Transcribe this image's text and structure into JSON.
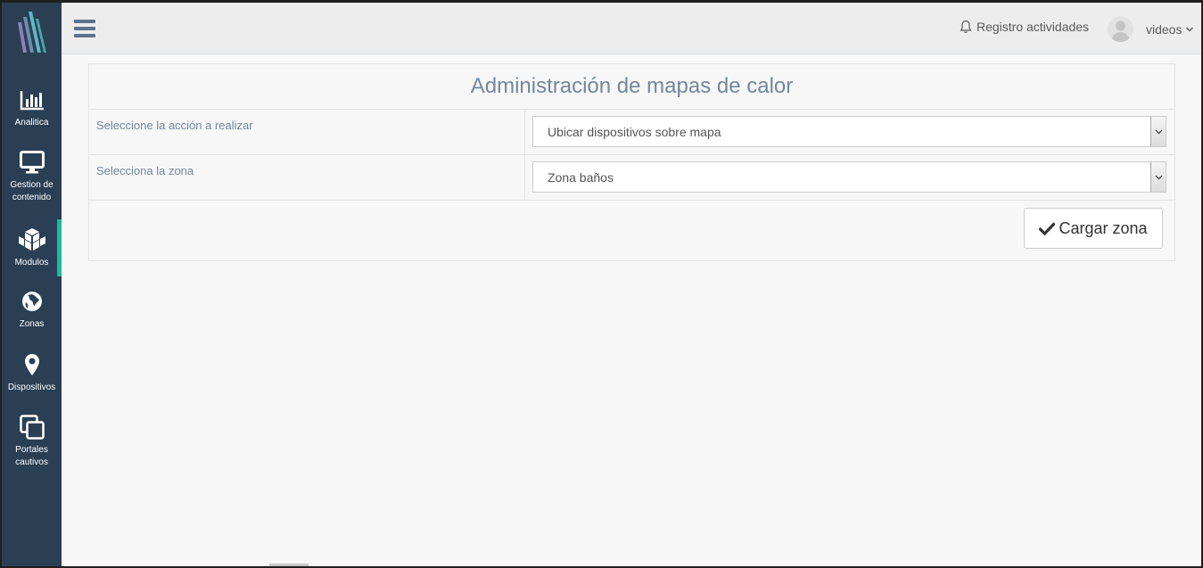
{
  "sidebar": {
    "items": [
      {
        "label": "Analitica",
        "icon": "bar-chart-icon"
      },
      {
        "label": "Gestion de contenido",
        "icon": "monitor-icon"
      },
      {
        "label": "Modulos",
        "icon": "cubes-icon"
      },
      {
        "label": "Zonas",
        "icon": "globe-icon"
      },
      {
        "label": "Dispositivos",
        "icon": "map-marker-icon"
      },
      {
        "label": "Portales cautivos",
        "icon": "clone-icon"
      }
    ],
    "active_index": 2,
    "accent": "#1abb9c",
    "bg": "#2a3f54"
  },
  "topbar": {
    "activity_label": "Registro actividades",
    "user_name": "videos"
  },
  "panel": {
    "title": "Administración de mapas de calor",
    "action_label": "Seleccione la acción a realizar",
    "action_value": "Ubicar dispositivos sobre mapa",
    "zone_label": "Selecciona la zona",
    "zone_value": "Zona baños",
    "submit_label": "Cargar zona"
  }
}
